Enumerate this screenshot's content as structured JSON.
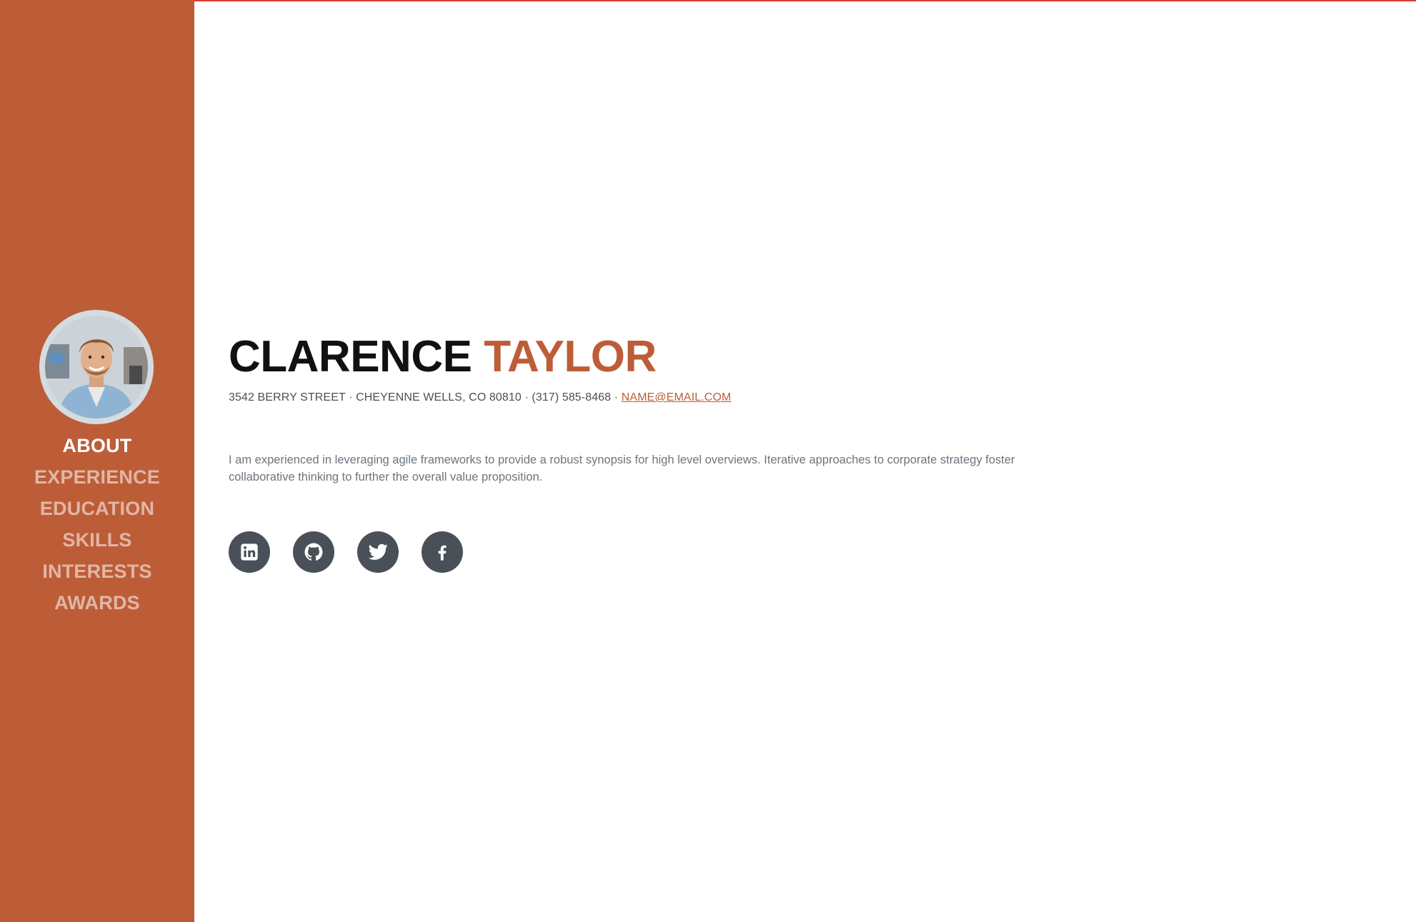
{
  "colors": {
    "sidebar": "#bd5d38",
    "accent": "#bd5d38",
    "top_line": "#dc3c32",
    "social_bg": "#495057",
    "text_body": "#6c757d"
  },
  "sidebar": {
    "avatar_icon": "profile-photo",
    "nav": [
      {
        "label": "ABOUT",
        "active": true
      },
      {
        "label": "EXPERIENCE",
        "active": false
      },
      {
        "label": "EDUCATION",
        "active": false
      },
      {
        "label": "SKILLS",
        "active": false
      },
      {
        "label": "INTERESTS",
        "active": false
      },
      {
        "label": "AWARDS",
        "active": false
      }
    ]
  },
  "about": {
    "first_name": "CLARENCE",
    "last_name": "TAYLOR",
    "address": "3542 BERRY STREET · CHEYENNE WELLS, CO 80810 · (317) 585-8468 · ",
    "email": "NAME@EMAIL.COM",
    "bio": "I am experienced in leveraging agile frameworks to provide a robust synopsis for high level overviews. Iterative approaches to corporate strategy foster collaborative thinking to further the overall value proposition."
  },
  "social": [
    {
      "icon": "linkedin-icon"
    },
    {
      "icon": "github-icon"
    },
    {
      "icon": "twitter-icon"
    },
    {
      "icon": "facebook-icon"
    }
  ]
}
